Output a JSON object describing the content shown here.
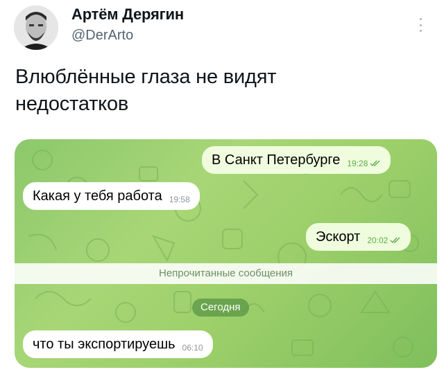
{
  "author": {
    "name": "Артём Дерягин",
    "handle": "@DerArto"
  },
  "tweet": {
    "text_line1": "Влюблённые глаза не видят",
    "text_line2": "недостатков"
  },
  "chat": {
    "messages": [
      {
        "direction": "out",
        "text": "В Санкт Петербурге",
        "time": "19:28"
      },
      {
        "direction": "in",
        "text": "Какая у тебя работа",
        "time": "19:58"
      },
      {
        "direction": "out",
        "text": "Эскорт",
        "time": "20:02"
      },
      {
        "direction": "in",
        "text": "что ты экспортируешь",
        "time": "06:10"
      }
    ],
    "unread_label": "Непрочитанные сообщения",
    "date_label": "Сегодня"
  },
  "colors": {
    "chat_bg": "#9ccf6a",
    "outgoing_bubble": "#effdde",
    "incoming_bubble": "#ffffff",
    "read_ticks": "#5eae4a"
  },
  "icons": {
    "more": "more-vertical-icon",
    "read_receipt": "double-check-icon"
  }
}
